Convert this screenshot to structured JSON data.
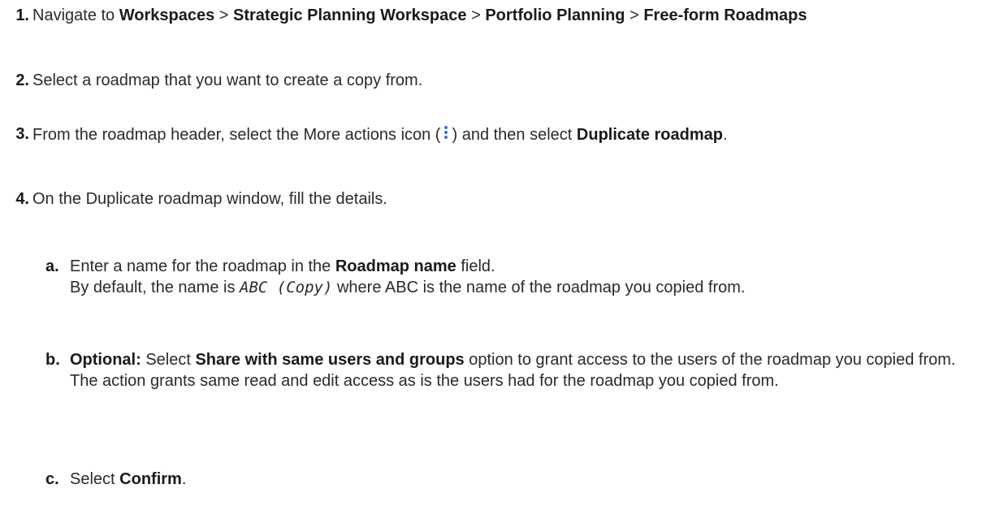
{
  "steps": [
    {
      "number": "1.",
      "pre": "Navigate to ",
      "crumb1": "Workspaces",
      "sep1": " > ",
      "crumb2": "Strategic Planning Workspace",
      "sep2": " > ",
      "crumb3": "Portfolio Planning",
      "sep3": " > ",
      "crumb4": "Free-form Roadmaps"
    },
    {
      "number": "2.",
      "text": "Select a roadmap that you want to create a copy from."
    },
    {
      "number": "3.",
      "pre": "From the roadmap header, select the More actions icon (",
      "icon": "more-actions-kebab-icon",
      "post": ") and then select ",
      "bold": "Duplicate roadmap",
      "end": "."
    },
    {
      "number": "4.",
      "text": "On the Duplicate roadmap window, fill the details."
    }
  ],
  "substeps": [
    {
      "letter": "a.",
      "pre": "Enter a name for the roadmap in the ",
      "bold": "Roadmap name",
      "post": " field.",
      "line2_pre": "By default, the name is ",
      "code": "ABC (Copy)",
      "line2_post": " where ABC is the name of the roadmap you copied from."
    },
    {
      "letter": "b.",
      "label": "Optional:",
      "pre": " Select ",
      "bold": "Share with same users and groups",
      "post": " option to grant access to the users of the roadmap you copied from.",
      "line2": "The action grants same read and edit access as is the users had for the roadmap you copied from."
    },
    {
      "letter": "c.",
      "pre": "Select ",
      "bold": "Confirm",
      "end": "."
    }
  ],
  "colors": {
    "text": "#2a2a2a",
    "icon": "#3b6fd6"
  }
}
